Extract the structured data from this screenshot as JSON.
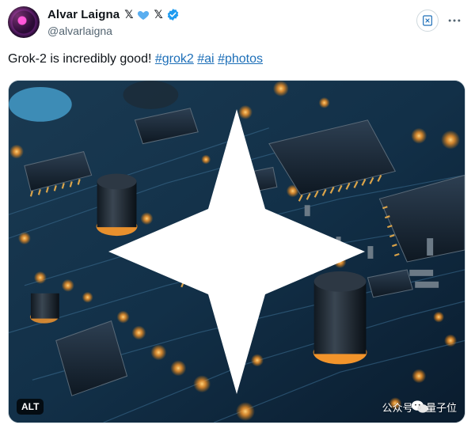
{
  "author": {
    "display_name": "Alvar Laigna",
    "badge_x": "𝕏",
    "handle": "@alvarlaigna"
  },
  "tweet": {
    "text": "Grok-2 is incredibly good!",
    "hashtags": [
      "#grok2",
      "#ai",
      "#photos"
    ]
  },
  "media": {
    "alt_label": "ALT",
    "watermark": {
      "source": "公众号",
      "separator": "·",
      "name": "量子位"
    }
  },
  "icons": {
    "verified": "verified-check-icon",
    "heart": "blue-heart-icon",
    "grok": "grok-icon",
    "more": "more-dots-icon",
    "wechat": "wechat-icon",
    "sparkle": "sparkle-icon"
  },
  "colors": {
    "link": "#1d6fb8",
    "verified": "#1d9bf0",
    "heart": "#5aaef0",
    "handle": "#536471"
  }
}
